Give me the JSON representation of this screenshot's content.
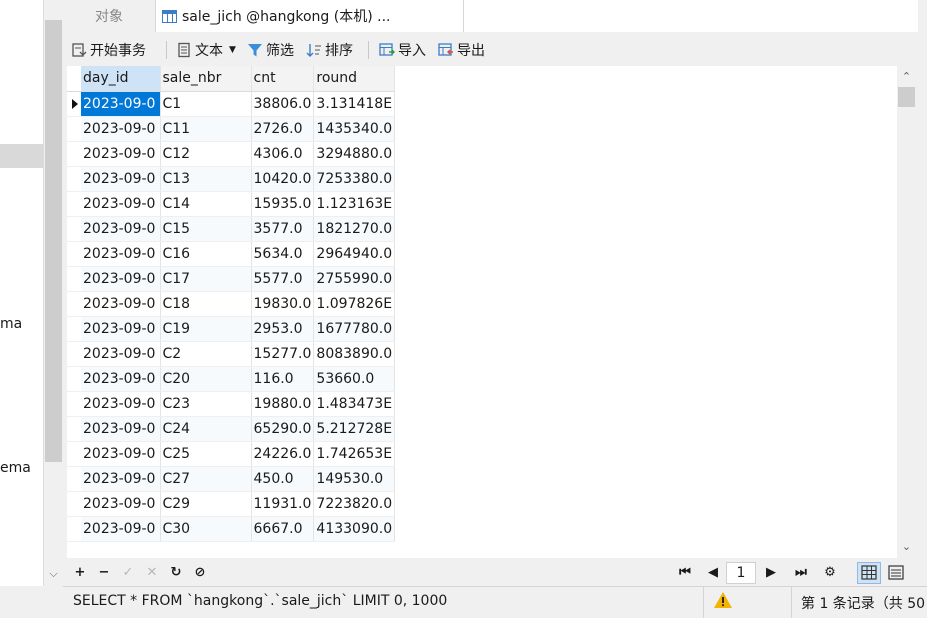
{
  "sidebar": {
    "texts": [
      "ma",
      "ema"
    ]
  },
  "tabs": {
    "objects_label": "对象",
    "active_label": "sale_jich @hangkong (本机) ..."
  },
  "toolbar": {
    "begin_txn": "开始事务",
    "text": "文本",
    "filter": "筛选",
    "sort": "排序",
    "import": "导入",
    "export": "导出"
  },
  "grid": {
    "columns": [
      "day_id",
      "sale_nbr",
      "cnt",
      "round"
    ],
    "rows": [
      [
        "2023-09-0",
        "C1",
        "38806.0",
        "3.131418E"
      ],
      [
        "2023-09-0",
        "C11",
        "2726.0",
        "1435340.0"
      ],
      [
        "2023-09-0",
        "C12",
        "4306.0",
        "3294880.0"
      ],
      [
        "2023-09-0",
        "C13",
        "10420.0",
        "7253380.0"
      ],
      [
        "2023-09-0",
        "C14",
        "15935.0",
        "1.123163E"
      ],
      [
        "2023-09-0",
        "C15",
        "3577.0",
        "1821270.0"
      ],
      [
        "2023-09-0",
        "C16",
        "5634.0",
        "2964940.0"
      ],
      [
        "2023-09-0",
        "C17",
        "5577.0",
        "2755990.0"
      ],
      [
        "2023-09-0",
        "C18",
        "19830.0",
        "1.097826E"
      ],
      [
        "2023-09-0",
        "C19",
        "2953.0",
        "1677780.0"
      ],
      [
        "2023-09-0",
        "C2",
        "15277.0",
        "8083890.0"
      ],
      [
        "2023-09-0",
        "C20",
        "116.0",
        "53660.0"
      ],
      [
        "2023-09-0",
        "C23",
        "19880.0",
        "1.483473E"
      ],
      [
        "2023-09-0",
        "C24",
        "65290.0",
        "5.212728E"
      ],
      [
        "2023-09-0",
        "C25",
        "24226.0",
        "1.742653E"
      ],
      [
        "2023-09-0",
        "C27",
        "450.0",
        "149530.0"
      ],
      [
        "2023-09-0",
        "C29",
        "11931.0",
        "7223820.0"
      ],
      [
        "2023-09-0",
        "C30",
        "6667.0",
        "4133090.0"
      ]
    ]
  },
  "nav": {
    "add": "+",
    "remove": "−",
    "apply": "✓",
    "discard": "✕",
    "refresh": "↻",
    "stop": "⊘",
    "first": "⏮",
    "prev": "◀",
    "page": "1",
    "next": "▶",
    "last": "⏭",
    "settings": "⚙"
  },
  "status": {
    "sql": "SELECT * FROM `hangkong`.`sale_jich` LIMIT 0, 1000",
    "records": "第 1 条记录（共 50"
  },
  "colors": {
    "selection": "#0078d7",
    "warning": "#f2b400",
    "table_icon": "#3b7dc7"
  }
}
